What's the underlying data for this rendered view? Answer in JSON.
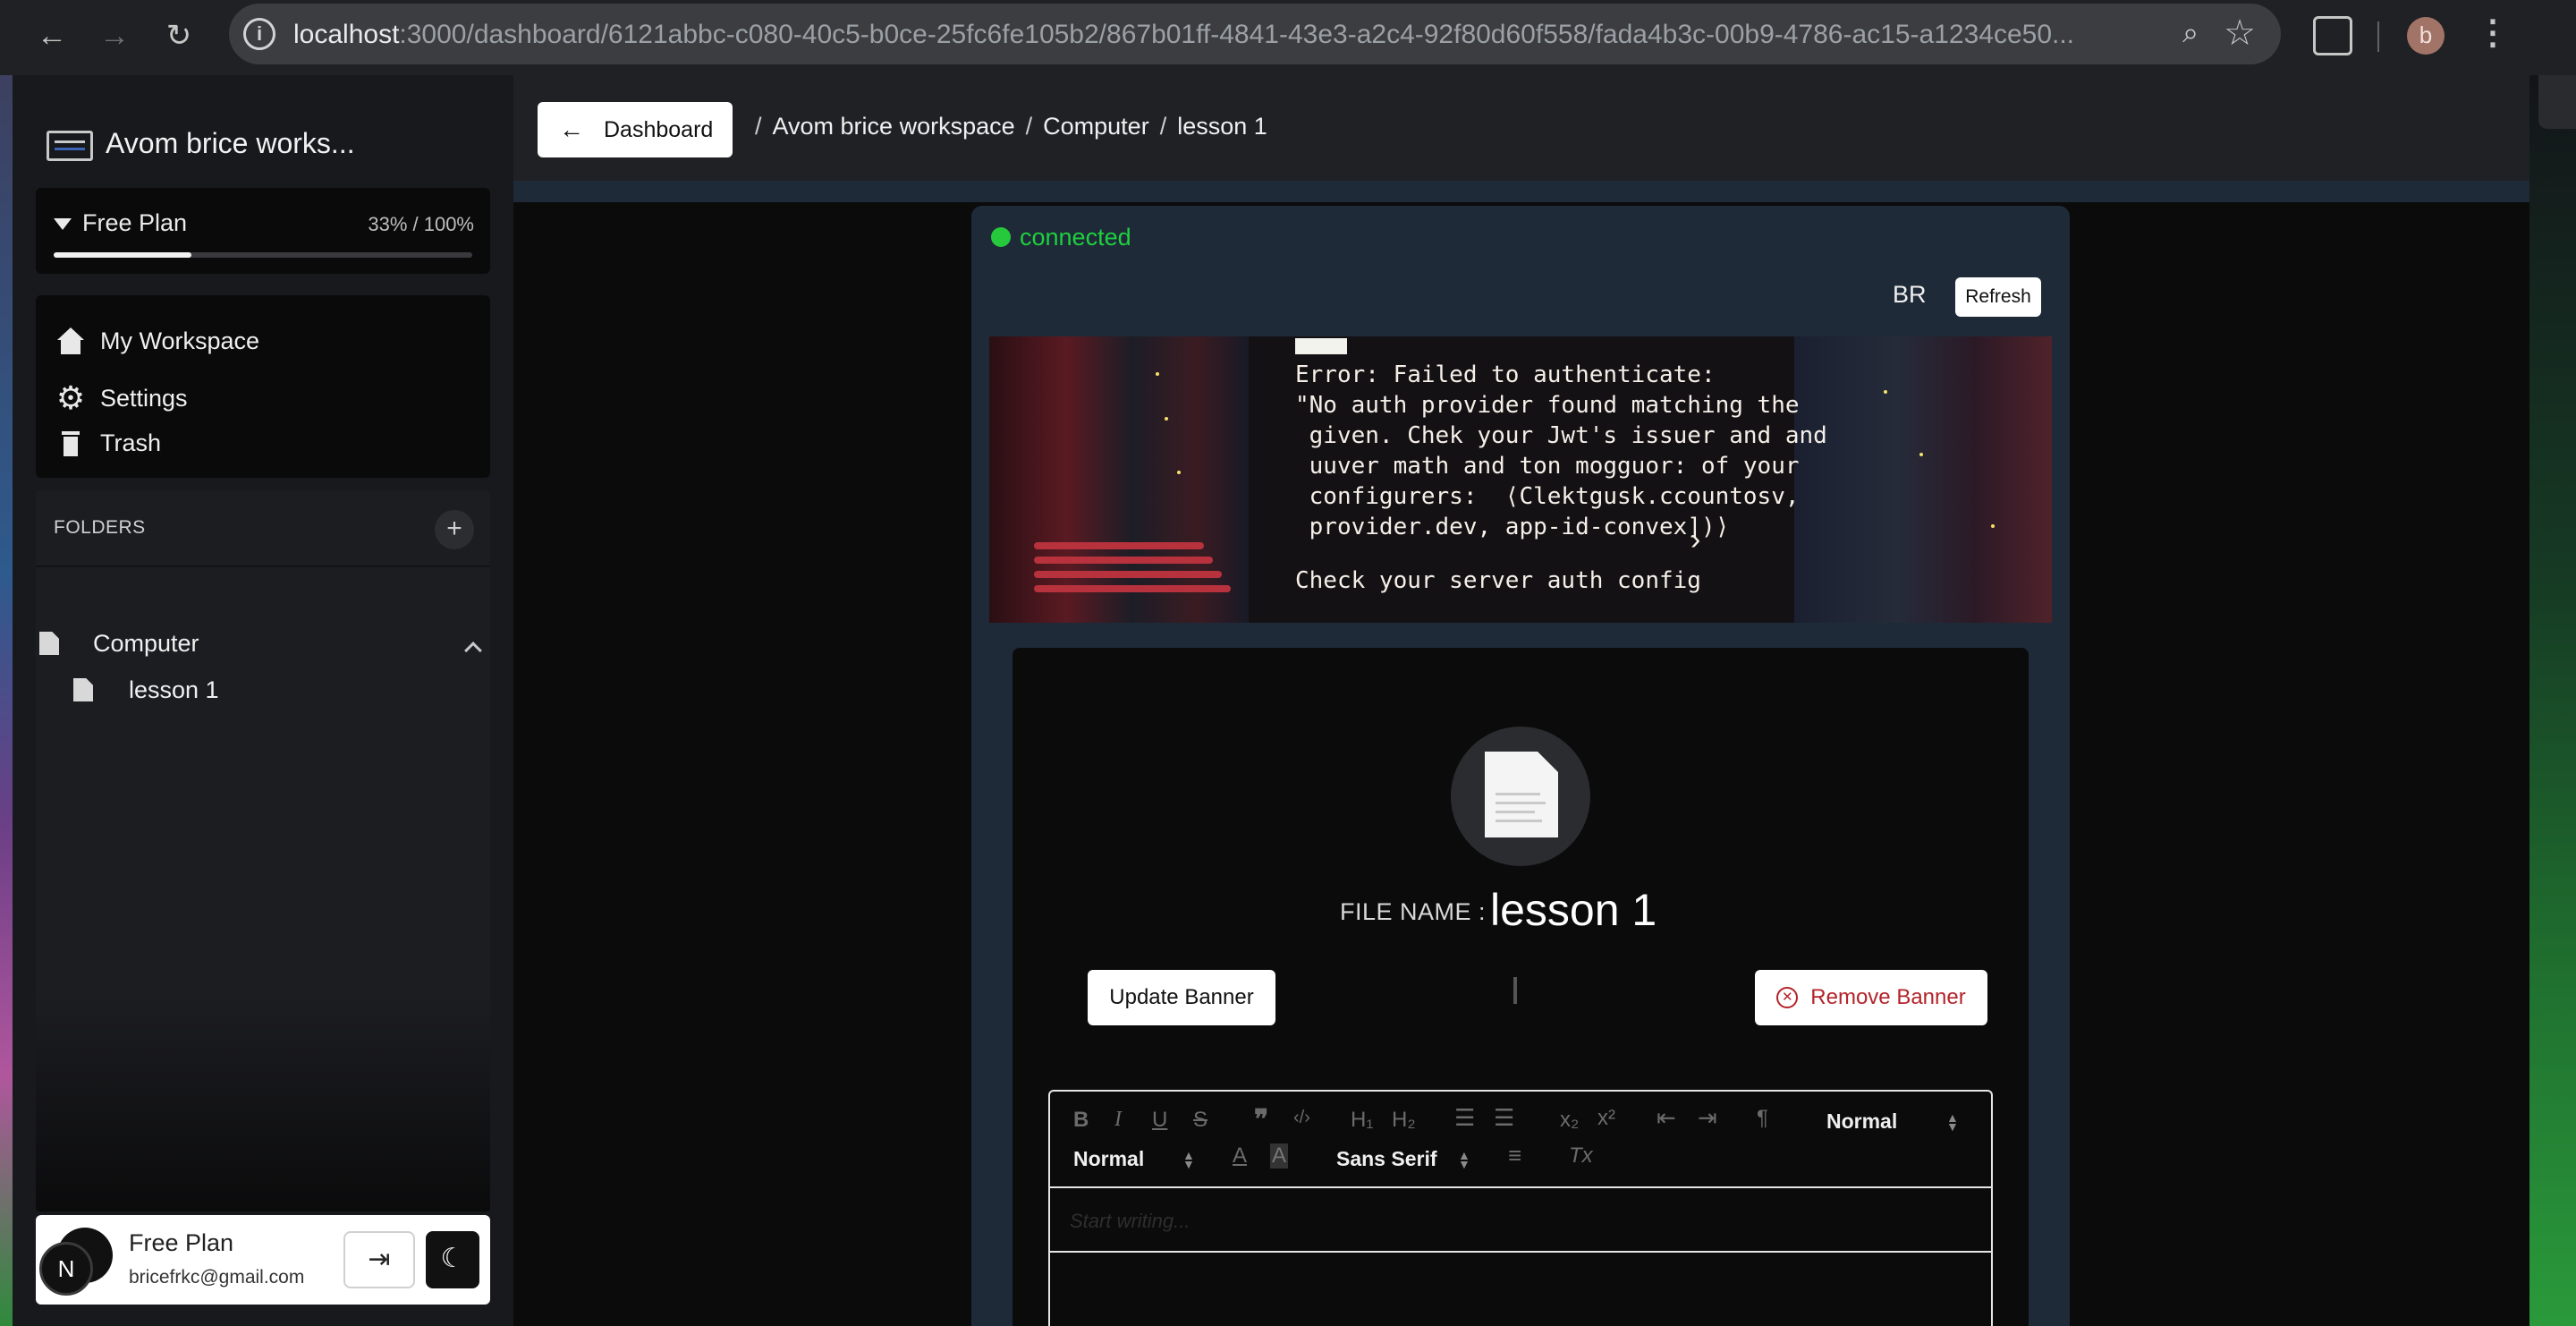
{
  "browser": {
    "url_host": "localhost",
    "url_rest": ":3000/dashboard/6121abbc-c080-40c5-b0ce-25fc6fe105b2/867b01ff-4841-43e3-a2c4-92f80d60f558/fada4b3c-00b9-4786-ac15-a1234ce50...",
    "profile_initial": "b",
    "icons": [
      "back-icon",
      "forward-icon",
      "reload-icon",
      "site-info-icon",
      "zoom-icon",
      "bookmark-star-icon",
      "extensions-icon",
      "menu-kebab-icon"
    ]
  },
  "sidebar": {
    "workspace_name": "Avom brice works...",
    "plan": {
      "label": "Free Plan",
      "usage_text": "33% / 100%",
      "usage_fraction": 0.33
    },
    "nav": [
      {
        "label": "My Workspace",
        "icon": "home-icon"
      },
      {
        "label": "Settings",
        "icon": "gear-icon"
      },
      {
        "label": "Trash",
        "icon": "trash-icon"
      }
    ],
    "folders_header": "FOLDERS",
    "folders": [
      {
        "name": "Computer",
        "files": [
          {
            "name": "lesson 1"
          }
        ]
      }
    ],
    "user": {
      "plan": "Free Plan",
      "email": "bricefrkc@gmail.com",
      "avatar_initial": "N"
    }
  },
  "header": {
    "back_label": "Dashboard",
    "breadcrumbs": [
      "Avom brice workspace",
      "Computer",
      "lesson 1"
    ]
  },
  "editor_card": {
    "status": "connected",
    "status_color": "#1fcf3f",
    "collaborator_initials": "BR",
    "refresh_label": "Refresh",
    "banner": {
      "error_text": "Error: Failed to authenticate:\n\"No auth provider found matching the\n given. Chek your Jwt's issuer and and\n uuver math and ton mogguor: of your\n configurers:  ⟨Clektgusk.ccountosv,\n provider.dev, app-id-convex])⟩",
      "check_text": "Check your server auth config"
    },
    "file_name_label": "FILE NAME :",
    "file_name": "lesson 1",
    "update_banner_label": "Update Banner",
    "remove_banner_label": "Remove Banner",
    "toolbar": {
      "header_select": "Normal",
      "size_select": "Normal",
      "font_select": "Sans Serif"
    },
    "placeholder": "Start writing..."
  }
}
